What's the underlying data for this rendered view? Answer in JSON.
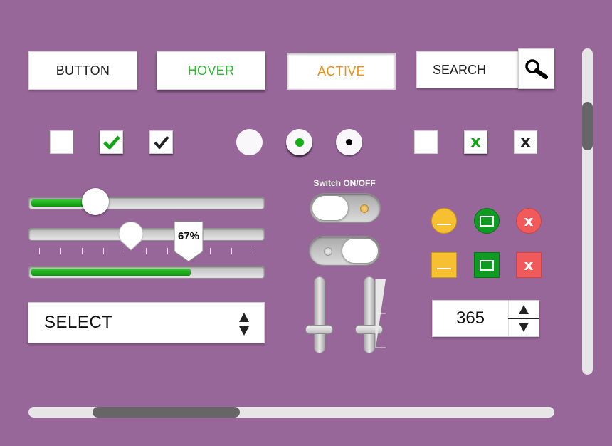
{
  "buttons": {
    "default_label": "BUTTON",
    "hover_label": "HOVER",
    "active_label": "ACTIVE",
    "hover_color": "#2fb52f",
    "active_color": "#f0900c"
  },
  "search": {
    "value": "SEARCH",
    "icon": "magnifier-icon"
  },
  "checkboxes": [
    {
      "state": "unchecked"
    },
    {
      "state": "checked",
      "mark": "check",
      "color": "#16a516"
    },
    {
      "state": "checked",
      "mark": "check",
      "color": "#222222"
    }
  ],
  "radios": [
    {
      "state": "unselected"
    },
    {
      "state": "selected",
      "color": "#16b016"
    },
    {
      "state": "selected",
      "color": "#000000"
    }
  ],
  "x_boxes": [
    {
      "state": "empty"
    },
    {
      "state": "marked",
      "mark": "x",
      "color": "#16a516"
    },
    {
      "state": "marked",
      "mark": "x",
      "color": "#222222"
    }
  ],
  "sliders": {
    "slider1_value": 0.29,
    "slider2_value": 0.44,
    "percent_label": "67%",
    "progress_value": 0.69
  },
  "select": {
    "value": "SELECT"
  },
  "switch": {
    "title": "Switch ON/OFF",
    "switch1_state": "off",
    "switch2_state": "on"
  },
  "window_controls": {
    "minimize_color": "#f6c031",
    "maximize_color": "#0f9a23",
    "close_color": "#f05a5a",
    "close_label": "x"
  },
  "stepper": {
    "value": "365"
  },
  "scrollbars": {
    "vertical_position": 0.17,
    "horizontal_position": 0.12
  },
  "colors": {
    "background": "#986799",
    "fill_green": "#0b960b",
    "thumb": "#666666"
  }
}
